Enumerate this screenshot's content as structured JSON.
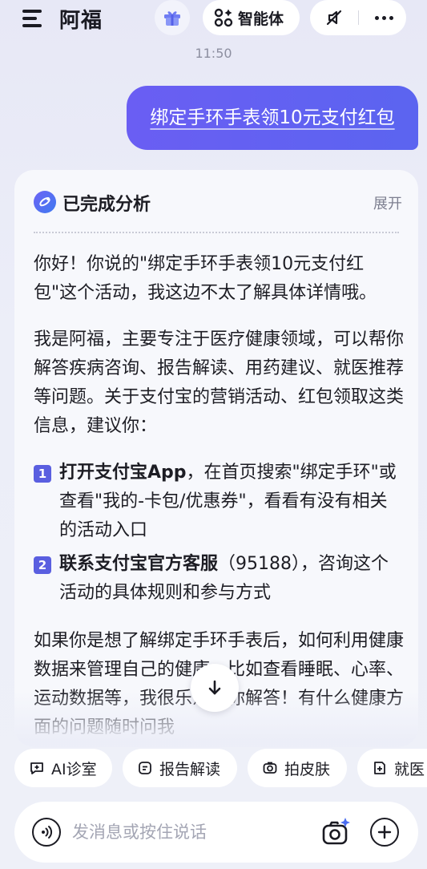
{
  "header": {
    "title": "阿福",
    "agent_label": "智能体",
    "icons": {
      "menu": "menu-icon",
      "gift": "gift-icon",
      "agent": "grid-icon",
      "mute": "mute-icon",
      "more": "more-icon"
    }
  },
  "chat": {
    "timestamp": "11:50",
    "user_message": "绑定手环手表领10元支付红包",
    "analysis": {
      "title": "已完成分析",
      "expand_label": "展开"
    },
    "reply": {
      "p1": "你好！你说的\"绑定手环手表领10元支付红包\"这个活动，我这边不太了解具体详情哦。",
      "p2": "我是阿福，主要专注于医疗健康领域，可以帮你解答疾病咨询、报告解读、用药建议、就医推荐等问题。关于支付宝的营销活动、红包领取这类信息，建议你：",
      "items": [
        {
          "num": "1",
          "bold": "打开支付宝App",
          "text": "，在首页搜索\"绑定手环\"或查看\"我的-卡包/优惠券\"，看看有没有相关的活动入口"
        },
        {
          "num": "2",
          "bold": "联系支付宝官方客服",
          "text": "（95188），咨询这个活动的具体规则和参与方式"
        }
      ],
      "p3": "如果你是想了解绑定手环手表后，如何利用健康数据来管理自己的健康，比如查看睡眠、心率、运动数据等，我很乐意帮你解答！有什么健康方面的问题随时问我"
    }
  },
  "quick_actions": [
    {
      "label": "AI诊室",
      "icon": "chat-plus-icon"
    },
    {
      "label": "报告解读",
      "icon": "report-icon"
    },
    {
      "label": "拍皮肤",
      "icon": "camera-icon"
    },
    {
      "label": "就医",
      "icon": "hospital-icon"
    }
  ],
  "input": {
    "placeholder": "发消息或按住说话"
  },
  "colors": {
    "accent": "#5b62f0",
    "background": "#e9eaf6",
    "card": "#f7f8fc"
  }
}
